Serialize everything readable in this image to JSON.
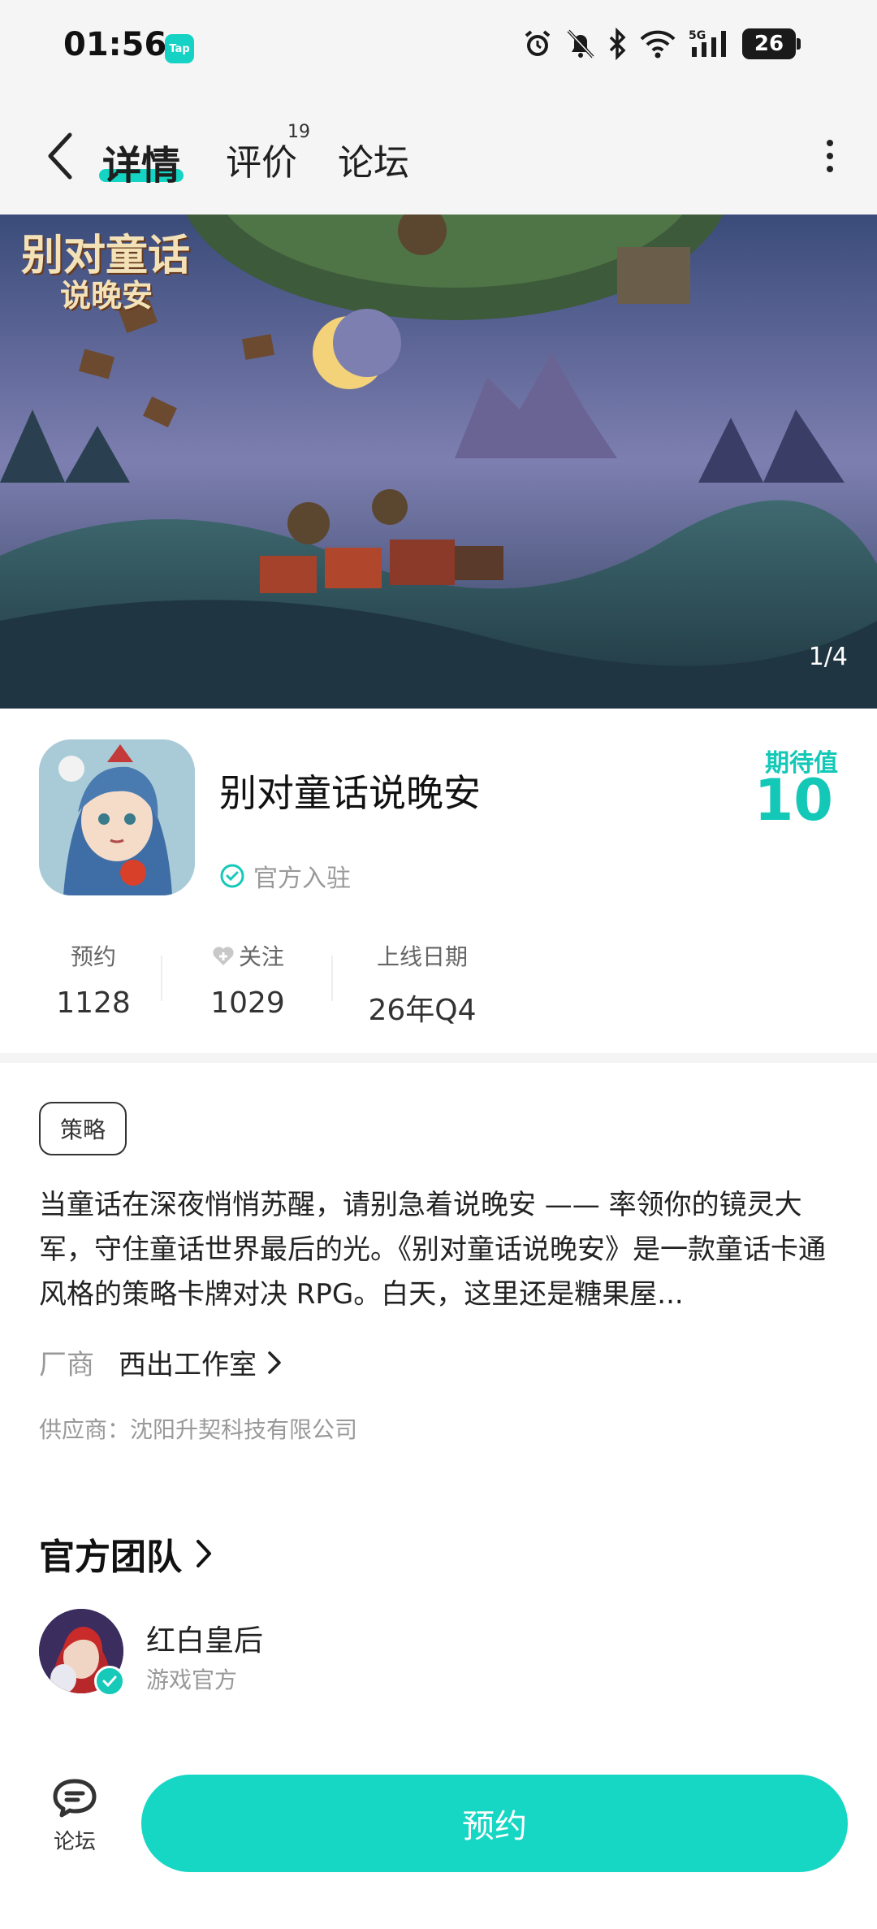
{
  "status_bar": {
    "time": "01:56",
    "app_badge": "Tap",
    "battery": "26",
    "icons": [
      "alarm-icon",
      "bell-off-icon",
      "bluetooth-icon",
      "wifi-icon",
      "signal-5g-icon",
      "battery-icon"
    ]
  },
  "nav": {
    "tabs": [
      {
        "label": "详情",
        "active": true
      },
      {
        "label": "评价",
        "count": "19"
      },
      {
        "label": "论坛"
      }
    ],
    "icons": [
      "back-arrow-icon",
      "more-vertical-icon"
    ]
  },
  "banner": {
    "logo_line1": "别对童话",
    "logo_line2": "说晚安",
    "page_indicator": "1/4"
  },
  "game": {
    "title": "别对童话说晚安",
    "official_label": "官方入驻",
    "expect_label": "期待值",
    "expect_value": "10",
    "stats": [
      {
        "label": "预约",
        "value": "1128"
      },
      {
        "label": "关注",
        "value": "1029",
        "icon": "heart-plus-icon"
      },
      {
        "label": "上线日期",
        "value": "26年Q4"
      }
    ],
    "tag": "策略",
    "description": "当童话在深夜悄悄苏醒，请别急着说晚安 —— 率领你的镜灵大军，守住童话世界最后的光。《别对童话说晚安》是一款童话卡通风格的策略卡牌对决 RPG。白天，这里还是糖果屋...",
    "vendor_label": "厂商",
    "vendor_name": "西出工作室",
    "supplier": "供应商：沈阳升契科技有限公司"
  },
  "team": {
    "title": "官方团队",
    "member_name": "红白皇后",
    "member_role": "游戏官方"
  },
  "bottom": {
    "forum_label": "论坛",
    "reserve_label": "预约"
  },
  "colors": {
    "accent": "#16d6c4",
    "accent_text": "#14c8b8",
    "status_bg": "#f5f5f5"
  }
}
